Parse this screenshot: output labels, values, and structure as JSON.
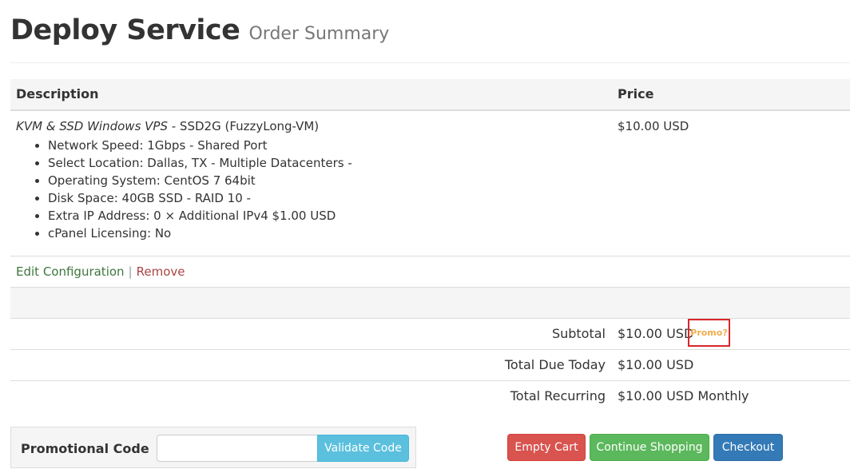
{
  "header": {
    "title": "Deploy Service",
    "subtitle": "Order Summary"
  },
  "table": {
    "col_description": "Description",
    "col_price": "Price",
    "item": {
      "product_name": "KVM & SSD Windows VPS",
      "product_detail": " - SSD2G (FuzzyLong-VM)",
      "price": "$10.00 USD",
      "options": [
        "Network Speed: 1Gbps - Shared Port",
        "Select Location: Dallas, TX - Multiple Datacenters -",
        "Operating System: CentOS 7 64bit",
        "Disk Space: 40GB SSD - RAID 10 -",
        "Extra IP Address: 0 × Additional IPv4 $1.00 USD",
        "cPanel Licensing: No"
      ]
    },
    "actions": {
      "edit": "Edit Configuration",
      "separator": "|",
      "remove": "Remove"
    },
    "totals": {
      "subtotal_label": "Subtotal",
      "subtotal_value": "$10.00 USD",
      "promo_link": "Promo?",
      "due_today_label": "Total Due Today",
      "due_today_value": "$10.00 USD",
      "recurring_label": "Total Recurring",
      "recurring_value": "$10.00 USD Monthly"
    }
  },
  "promo": {
    "label": "Promotional Code",
    "input_value": "",
    "input_placeholder": "",
    "validate_label": "Validate Code"
  },
  "buttons": {
    "empty_cart": "Empty Cart",
    "continue_shopping": "Continue Shopping",
    "checkout": "Checkout"
  },
  "colors": {
    "edit_link": "#3c763d",
    "remove_link": "#a94442",
    "promo_link": "#f0ad4e",
    "promo_highlight": "#d9262b",
    "validate": "#5bc0de",
    "empty": "#d9534f",
    "continue": "#5cb85c",
    "checkout": "#337ab7"
  }
}
